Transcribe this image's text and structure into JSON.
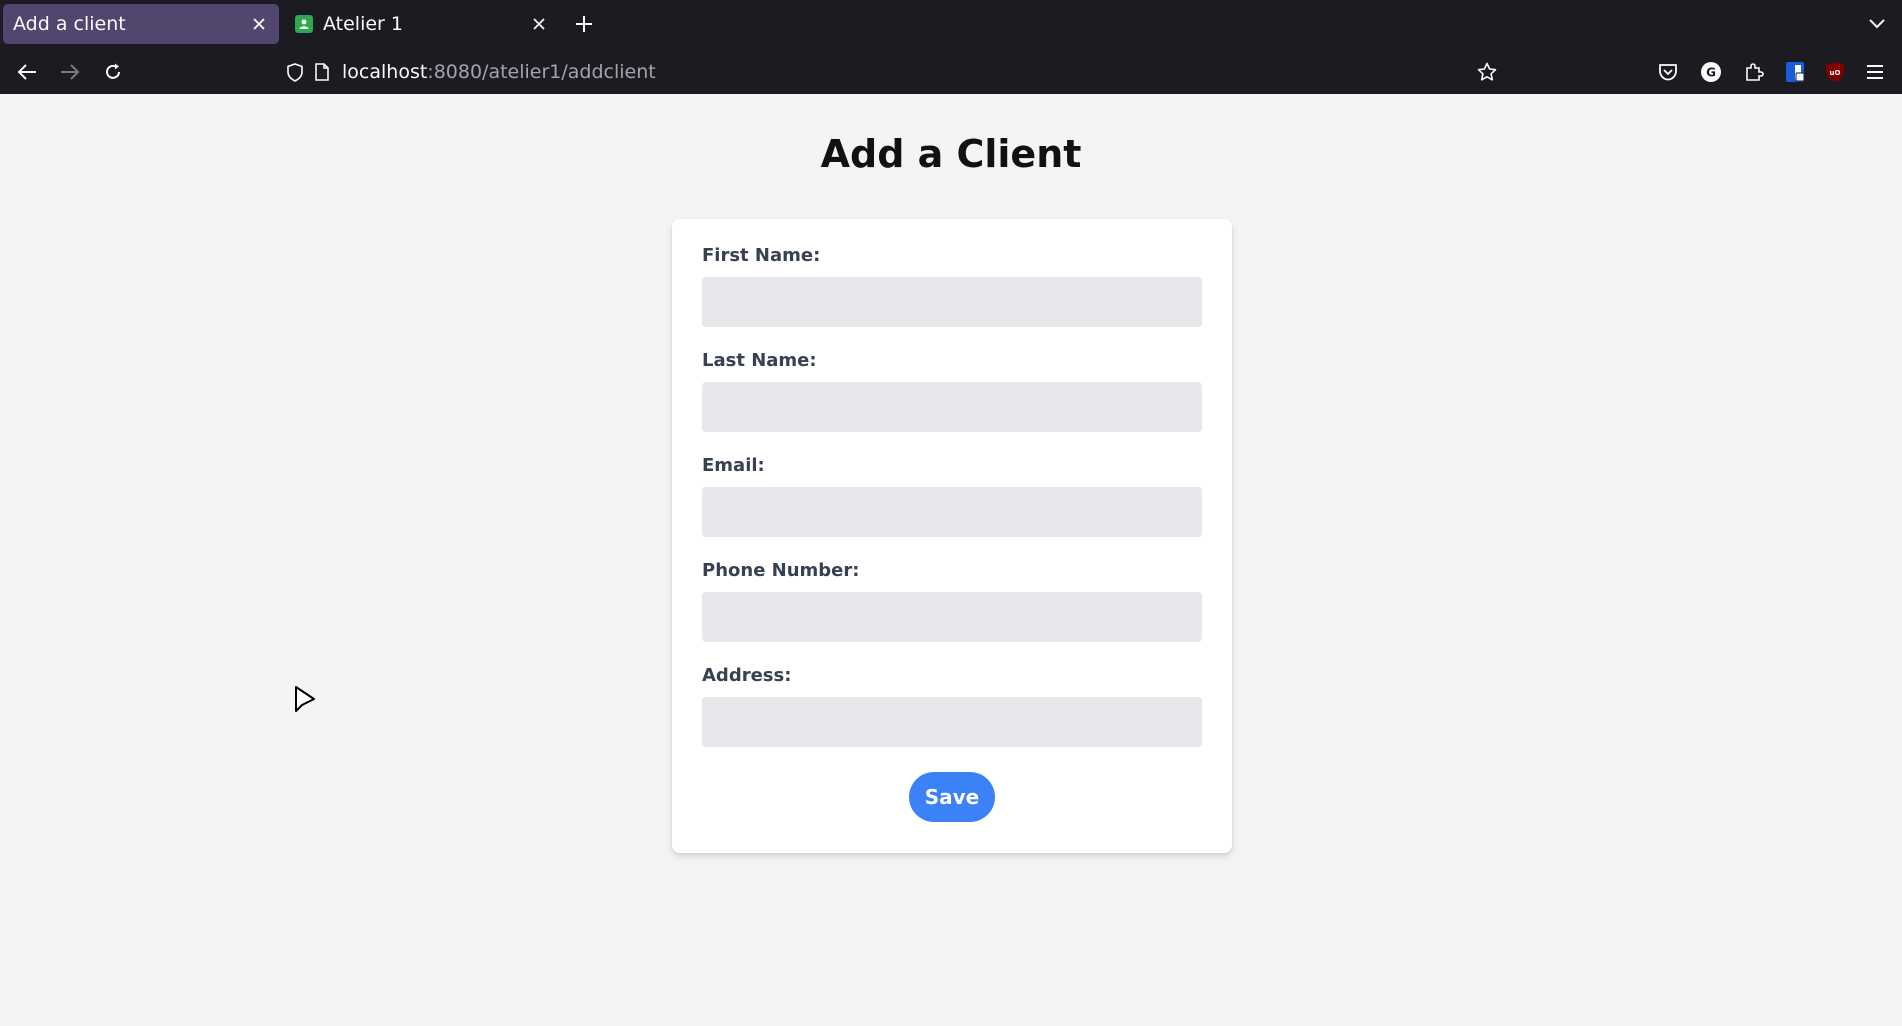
{
  "browser": {
    "tabs": [
      {
        "title": "Add a client",
        "active": true
      },
      {
        "title": "Atelier 1",
        "active": false
      }
    ],
    "url": {
      "host": "localhost",
      "rest": ":8080/atelier1/addclient"
    },
    "icons": {
      "new_tab": "plus-icon",
      "back": "arrow-left-icon",
      "forward": "arrow-right-icon",
      "reload": "reload-icon",
      "bookmark": "star-icon",
      "menu": "hamburger-icon"
    }
  },
  "page": {
    "title": "Add a Client",
    "form": {
      "fields": [
        {
          "label": "First Name:",
          "value": "",
          "placeholder": ""
        },
        {
          "label": "Last Name:",
          "value": "",
          "placeholder": ""
        },
        {
          "label": "Email:",
          "value": "",
          "placeholder": ""
        },
        {
          "label": "Phone Number:",
          "value": "",
          "placeholder": ""
        },
        {
          "label": "Address:",
          "value": "",
          "placeholder": ""
        }
      ],
      "submit_label": "Save"
    }
  },
  "colors": {
    "tab_active": "#52466e",
    "chrome_bg": "#1c1b22",
    "page_bg": "#f3f4f6",
    "input_bg": "#e5e7eb",
    "button_bg": "#3b82f6"
  }
}
